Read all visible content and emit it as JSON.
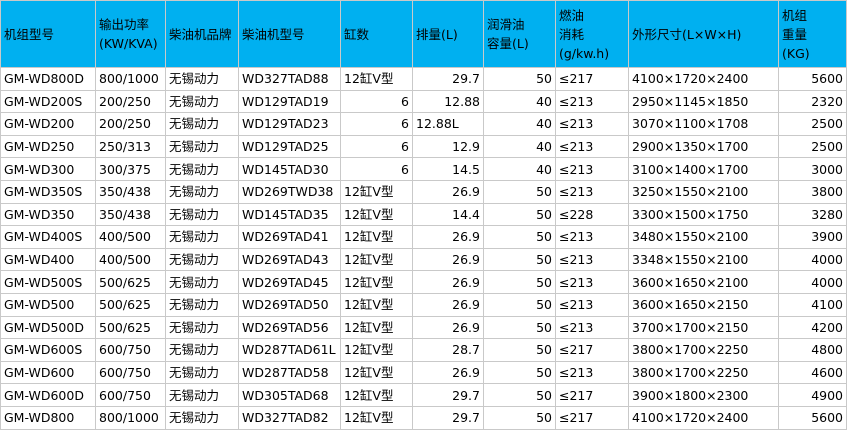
{
  "table": {
    "headers": [
      [
        "机组型号"
      ],
      [
        "输出功率",
        "(KW/KVA)"
      ],
      [
        "柴油机品牌"
      ],
      [
        "柴油机型号"
      ],
      [
        "缸数"
      ],
      [
        "排量(L)"
      ],
      [
        "润滑油",
        "容量(L)"
      ],
      [
        "燃油",
        "消耗",
        "(g/kw.h)"
      ],
      [
        "外形尺寸(L×W×H)"
      ],
      [
        "机组",
        "重量",
        "(KG)"
      ]
    ],
    "rows": [
      [
        "GM-WD800D",
        "800/1000",
        "无锡动力",
        "WD327TAD88",
        "12缸V型",
        "29.7",
        "50",
        "≤217",
        "4100×1720×2400",
        "5600"
      ],
      [
        "GM-WD200S",
        "200/250",
        "无锡动力",
        "WD129TAD19",
        "6",
        "12.88",
        "40",
        "≤213",
        "2950×1145×1850",
        "2320"
      ],
      [
        "GM-WD200",
        "200/250",
        "无锡动力",
        "WD129TAD23",
        "6",
        "12.88L",
        "40",
        "≤213",
        "3070×1100×1708",
        "2500"
      ],
      [
        "GM-WD250",
        "250/313",
        "无锡动力",
        "WD129TAD25",
        "6",
        "12.9",
        "40",
        "≤213",
        "2900×1350×1700",
        "2500"
      ],
      [
        "GM-WD300",
        "300/375",
        "无锡动力",
        "WD145TAD30",
        "6",
        "14.5",
        "40",
        "≤213",
        "3100×1400×1700",
        "3000"
      ],
      [
        "GM-WD350S",
        "350/438",
        "无锡动力",
        "WD269TWD38",
        "12缸V型",
        "26.9",
        "50",
        "≤213",
        "3250×1550×2100",
        "3800"
      ],
      [
        "GM-WD350",
        "350/438",
        "无锡动力",
        "WD145TAD35",
        "12缸V型",
        "14.4",
        "50",
        "≤228",
        "3300×1500×1750",
        "3280"
      ],
      [
        "GM-WD400S",
        "400/500",
        "无锡动力",
        "WD269TAD41",
        "12缸V型",
        "26.9",
        "50",
        "≤213",
        "3480×1550×2100",
        "3900"
      ],
      [
        "GM-WD400",
        "400/500",
        "无锡动力",
        "WD269TAD43",
        "12缸V型",
        "26.9",
        "50",
        "≤213",
        "3348×1550×2100",
        "4000"
      ],
      [
        "GM-WD500S",
        "500/625",
        "无锡动力",
        "WD269TAD45",
        "12缸V型",
        "26.9",
        "50",
        "≤213",
        "3600×1650×2100",
        "4000"
      ],
      [
        "GM-WD500",
        "500/625",
        "无锡动力",
        "WD269TAD50",
        "12缸V型",
        "26.9",
        "50",
        "≤213",
        "3600×1650×2150",
        "4100"
      ],
      [
        "GM-WD500D",
        "500/625",
        "无锡动力",
        "WD269TAD56",
        "12缸V型",
        "26.9",
        "50",
        "≤213",
        "3700×1700×2150",
        "4200"
      ],
      [
        "GM-WD600S",
        "600/750",
        "无锡动力",
        "WD287TAD61L",
        "12缸V型",
        "28.7",
        "50",
        "≤217",
        "3800×1700×2250",
        "4800"
      ],
      [
        "GM-WD600",
        "600/750",
        "无锡动力",
        "WD287TAD58",
        "12缸V型",
        "26.9",
        "50",
        "≤213",
        "3800×1700×2250",
        "4600"
      ],
      [
        "GM-WD600D",
        "600/750",
        "无锡动力",
        "WD305TAD68",
        "12缸V型",
        "29.7",
        "50",
        "≤217",
        "3900×1800×2300",
        "4900"
      ],
      [
        "GM-WD800",
        "800/1000",
        "无锡动力",
        "WD327TAD82",
        "12缸V型",
        "29.7",
        "50",
        "≤217",
        "4100×1720×2400",
        "5600"
      ]
    ]
  },
  "colors": {
    "header_bg": "#00b0f0",
    "border": "#c9c9c9"
  }
}
